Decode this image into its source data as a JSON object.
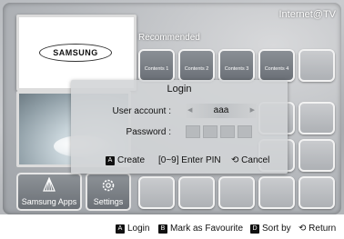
{
  "header": {
    "brand_title": "Internet@TV"
  },
  "preview": {
    "logo_text": "SAMSUNG"
  },
  "recommended": {
    "label": "Recommended",
    "tiles": [
      "Contents 1",
      "Contents 2",
      "Contents 3",
      "Contents 4",
      ""
    ]
  },
  "side_buttons": {
    "apps": {
      "label": "Samsung Apps",
      "icon": "samsung-apps-icon"
    },
    "settings": {
      "label": "Settings",
      "icon": "gear-icon"
    }
  },
  "login_dialog": {
    "title": "Login",
    "user_account_label": "User account :",
    "user_account_value": "aaa",
    "password_label": "Password :",
    "pin_boxes": 4,
    "actions": {
      "create_key": "A",
      "create_label": "Create",
      "enter_pin_label": "[0~9] Enter PIN",
      "cancel_label": "Cancel"
    }
  },
  "legend": {
    "login_key": "A",
    "login_label": "Login",
    "favourite_key": "B",
    "favourite_label": "Mark as Favourite",
    "sort_key": "D",
    "sort_label": "Sort by",
    "return_label": "Return"
  },
  "colors": {
    "background": "#b5b8bc",
    "tile_border": "#f2f2f2",
    "dialog_bg": "#d2d4d6"
  }
}
